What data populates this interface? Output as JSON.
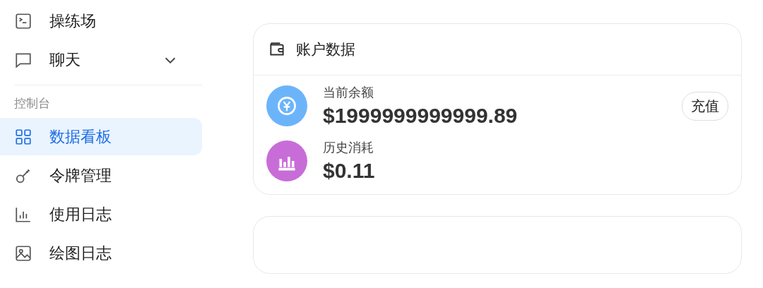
{
  "sidebar": {
    "top_items": [
      {
        "kind": "terminal",
        "label": "操练场",
        "selected": false
      },
      {
        "kind": "chat",
        "label": "聊天",
        "selected": false,
        "expanded": false
      }
    ],
    "section": {
      "title": "控制台",
      "items": [
        {
          "kind": "grid",
          "label": "数据看板",
          "selected": true
        },
        {
          "kind": "key",
          "label": "令牌管理",
          "selected": false
        },
        {
          "kind": "bars",
          "label": "使用日志",
          "selected": false
        },
        {
          "kind": "image",
          "label": "绘图日志",
          "selected": false
        }
      ]
    }
  },
  "account_card": {
    "title": "账户数据",
    "stats": [
      {
        "kind": "currency",
        "color": "#6cb4fa",
        "label": "当前余额",
        "value": "$1999999999999.89",
        "action": "充值"
      },
      {
        "kind": "chart",
        "color": "#c86dd7",
        "label": "历史消耗",
        "value": "$0.11"
      }
    ]
  }
}
